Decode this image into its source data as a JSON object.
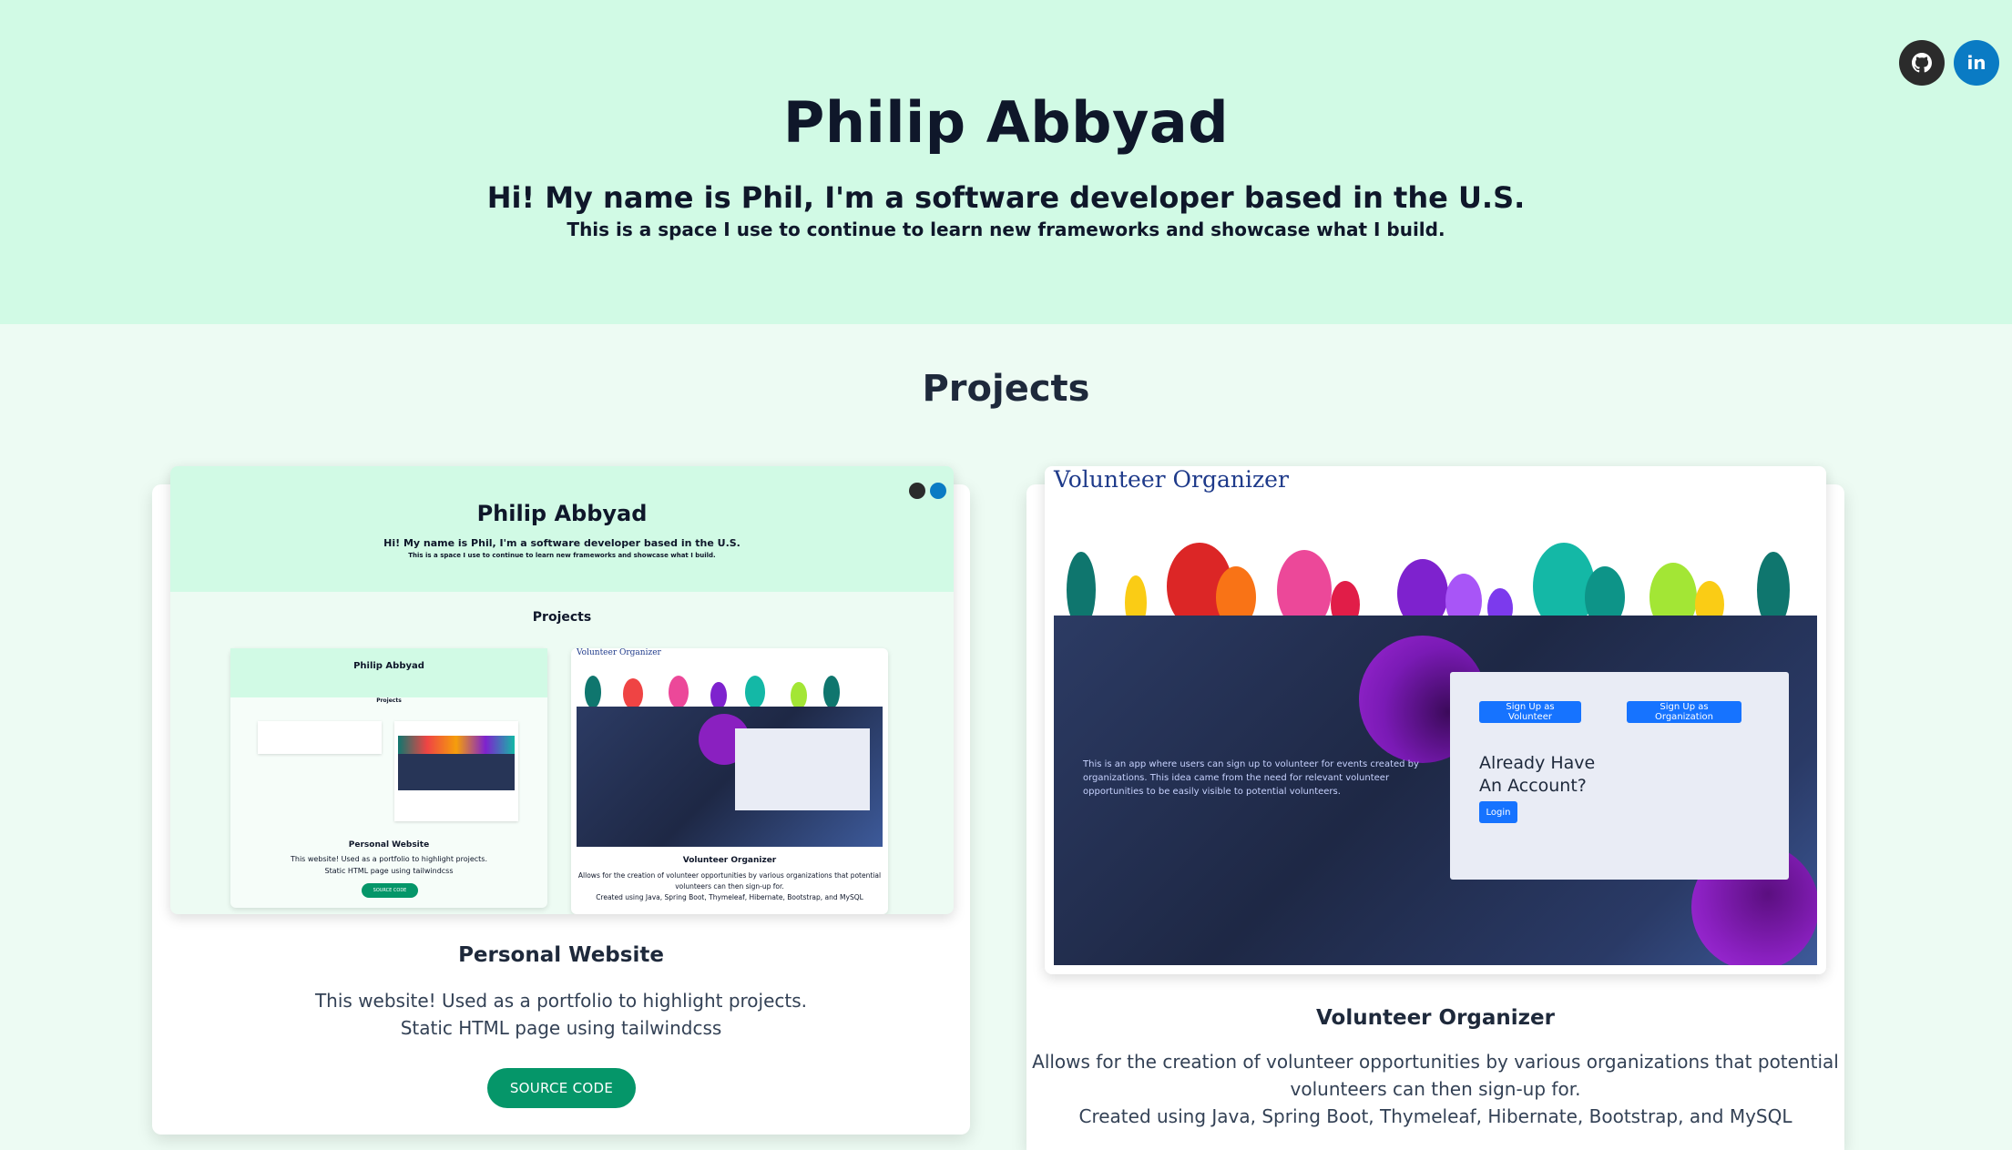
{
  "hero": {
    "name": "Philip Abbyad",
    "intro": "Hi! My name is Phil, I'm a software developer based in the U.S.",
    "sub": "This is a space I use to continue to learn new frameworks and showcase what I build."
  },
  "social": {
    "github_icon": "github-icon",
    "linkedin_icon": "linkedin-icon",
    "linkedin_text": "in"
  },
  "section_title": "Projects",
  "projects": [
    {
      "title": "Personal Website",
      "desc_line1": "This website! Used as a portfolio to highlight projects.",
      "desc_line2": "Static HTML page using tailwindcss",
      "button": "SOURCE CODE"
    },
    {
      "title": "Volunteer Organizer",
      "desc_line1": "Allows for the creation of volunteer opportunities by various organizations that potential",
      "desc_line2": "volunteers can then sign-up for.",
      "desc_line3": "Created using Java, Spring Boot, Thymeleaf, Hibernate, Bootstrap, and MySQL"
    }
  ],
  "volunteer_app": {
    "title": "Volunteer Organizer",
    "about": "This is an app where users can sign up to volunteer for events created by organizations. This idea came from the need for relevant volunteer opportunities to be easily visible to potential volunteers.",
    "btn_volunteer": "Sign Up as Volunteer",
    "btn_org": "Sign Up as Organization",
    "login_heading_1": "Already Have",
    "login_heading_2": "An Account?",
    "login_btn": "Login"
  },
  "colors": {
    "hero_bg": "#d1fae5",
    "accent_green": "#059669",
    "github": "#2b2b2b",
    "linkedin": "#0a7bc4",
    "app_blue": "#1673ff"
  }
}
